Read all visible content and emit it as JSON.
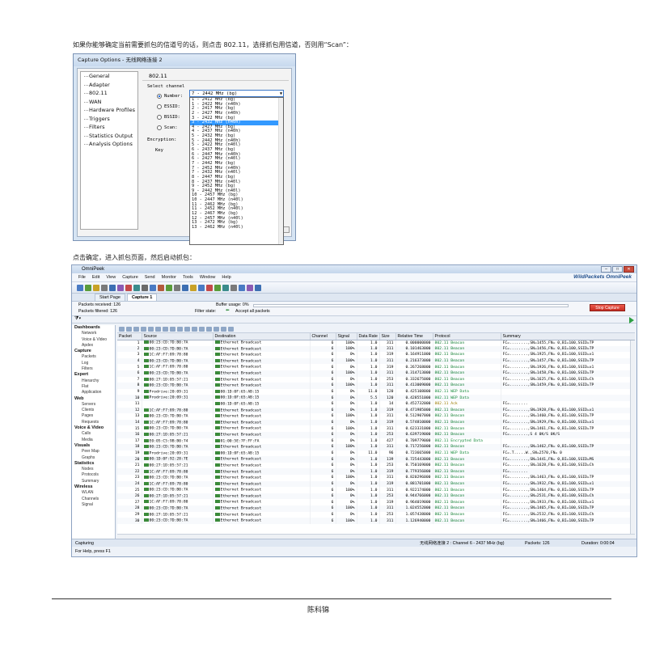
{
  "doc": {
    "caption_top": "如果你能够确定当前需要抓包的信道号的话，则点击 802.11，选择抓包用信道，否则用“Scan”：",
    "caption_mid": "点击确定，进入抓包页面，然后启动抓包：",
    "footer": "陈科锦"
  },
  "dialog": {
    "title": "Capture Options - 无线网络连接 2",
    "tree": [
      "General",
      "Adapter",
      "802.11",
      "WAN",
      "Hardware Profiles",
      "Triggers",
      "Filters",
      "Statistics Output",
      "Analysis Options"
    ],
    "panel_title": "802.11",
    "select_channel_label": "Select channel",
    "options": [
      "Number:",
      "ESSID:",
      "BSSID:",
      "Scan:"
    ],
    "encryption_label": "Encryption:",
    "key_label": "Key",
    "selected_value": "7 - 2442 MHz (bg)",
    "dropdown": [
      "1 - 2412 MHz (bg)",
      "1 - 2422 MHz (n40h)",
      "2 - 2417 MHz (bg)",
      "2 - 2427 MHz (n40h)",
      "3 - 2422 MHz (bg)",
      "3 - 2432 MHz (n40h)",
      "4 - 2427 MHz (bg)",
      "4 - 2437 MHz (n40h)",
      "5 - 2432 MHz (bg)",
      "5 - 2442 MHz (n40h)",
      "5 - 2422 MHz (n40l)",
      "6 - 2437 MHz (bg)",
      "6 - 2447 MHz (n40h)",
      "6 - 2427 MHz (n40l)",
      "7 - 2442 MHz (bg)",
      "7 - 2452 MHz (n40h)",
      "7 - 2432 MHz (n40l)",
      "8 - 2447 MHz (bg)",
      "8 - 2437 MHz (n40l)",
      "9 - 2452 MHz (bg)",
      "9 - 2442 MHz (n40l)",
      "10 - 2457 MHz (bg)",
      "10 - 2447 MHz (n40l)",
      "11 - 2462 MHz (bg)",
      "11 - 2452 MHz (n40l)",
      "12 - 2467 MHz (bg)",
      "12 - 2457 MHz (n40l)",
      "13 - 2472 MHz (bg)",
      "13 - 2462 MHz (n40l)"
    ],
    "dropdown_selected_index": 5
  },
  "app": {
    "title": "OmniPeek",
    "menu": [
      "File",
      "Edit",
      "View",
      "Capture",
      "Send",
      "Monitor",
      "Tools",
      "Window",
      "Help"
    ],
    "brand": "WildPackets OmniPeek",
    "tabs": [
      "Start Page",
      "Capture 1"
    ],
    "status": {
      "packets_received": "Packets received: 126",
      "packets_filtered": "Packets filtered: 126",
      "buffer_usage": "Buffer usage: 0%",
      "filter_state": "Filter state:",
      "filter_value": "Accept all packets",
      "stop_button": "Stop Capture"
    },
    "nav": [
      {
        "cat": "Dashboards",
        "items": [
          "Network",
          "Voice & Video",
          "Apdex"
        ]
      },
      {
        "cat": "Capture",
        "items": [
          "Packets",
          "Log",
          "Filters"
        ]
      },
      {
        "cat": "Expert",
        "items": [
          "Hierarchy",
          "Flat",
          "Application"
        ]
      },
      {
        "cat": "Web",
        "items": [
          "Servers",
          "Clients",
          "Pages",
          "Requests"
        ]
      },
      {
        "cat": "Voice & Video",
        "items": [
          "Calls",
          "Media"
        ]
      },
      {
        "cat": "Visuals",
        "items": [
          "Peer Map",
          "Graphs"
        ]
      },
      {
        "cat": "Statistics",
        "items": [
          "Nodes",
          "Protocols",
          "Summary"
        ]
      },
      {
        "cat": "Wireless",
        "items": [
          "WLAN",
          "Channels",
          "Signal"
        ]
      }
    ],
    "columns": [
      "Packet",
      "Source",
      "Destination",
      "Channel",
      "Signal",
      "Data Rate",
      "Size",
      "Relative Time",
      "Protocol",
      "Summary"
    ],
    "rows": [
      [
        "1",
        "00:23:CD:7D:B0:7A",
        "Ethernet Broadcast",
        "6",
        "100%",
        "1.0",
        "311",
        "0.000000000",
        "802.11 Beacon",
        "FC=........,SN=1455,FN= 0,BI=100,SSID=TP"
      ],
      [
        "2",
        "00:23:CD:7D:B0:7A",
        "Ethernet Broadcast",
        "6",
        "100%",
        "1.0",
        "311",
        "0.101463000",
        "802.11 Beacon",
        "FC=........,SN=1456,FN= 0,BI=100,SSID=TP"
      ],
      [
        "3",
        "1C:AF:F7:89:78:80",
        "Ethernet Broadcast",
        "6",
        "0%",
        "1.0",
        "319",
        "0.164911000",
        "802.11 Beacon",
        "FC=........,SN=1925,FN= 0,BI=100,SSID=x1"
      ],
      [
        "4",
        "00:23:CD:7D:B0:7A",
        "Ethernet Broadcast",
        "6",
        "100%",
        "1.0",
        "311",
        "0.216373000",
        "802.11 Beacon",
        "FC=........,SN=1457,FN= 0,BI=100,SSID=TP"
      ],
      [
        "5",
        "1C:AF:F7:89:78:80",
        "Ethernet Broadcast",
        "6",
        "0%",
        "1.0",
        "319",
        "0.267268000",
        "802.11 Beacon",
        "FC=........,SN=1926,FN= 0,BI=100,SSID=x1"
      ],
      [
        "6",
        "00:23:CD:7D:B0:7A",
        "Ethernet Broadcast",
        "6",
        "100%",
        "1.0",
        "311",
        "0.314713000",
        "802.11 Beacon",
        "FC=........,SN=1458,FN= 0,BI=100,SSID=TP"
      ],
      [
        "7",
        "00:27:1D:05:57:21",
        "Ethernet Broadcast",
        "6",
        "0%",
        "1.0",
        "253",
        "0.332675000",
        "802.11 Beacon",
        "FC=........,SN=1625,FN= 0,BI=100,SSID=Ch"
      ],
      [
        "8",
        "00:23:CD:7D:B0:7A",
        "Ethernet Broadcast",
        "6",
        "100%",
        "1.0",
        "311",
        "0.413009000",
        "802.11 Beacon",
        "FC=........,SN=1459,FN= 0,BI=100,SSID=TP"
      ],
      [
        "9",
        "Prodrive:20:09:31",
        "00:1D:0F:65:AB:15",
        "6",
        "0%",
        "11.0",
        "120",
        "0.425108000",
        "802.11 WEP Data",
        ""
      ],
      [
        "10",
        "Prodrive:20:09:31",
        "00:1D:0F:65:AB:15",
        "6",
        "0%",
        "5.5",
        "120",
        "0.428551000",
        "802.11 WEP Data",
        ""
      ],
      [
        "11",
        "",
        "00:1D:0F:65:AB:15",
        "6",
        "0%",
        "1.0",
        "14",
        "0.452732000",
        "802.11 Ack",
        "FC=........"
      ],
      [
        "12",
        "1C:AF:F7:89:78:80",
        "Ethernet Broadcast",
        "6",
        "0%",
        "1.0",
        "319",
        "0.471985000",
        "802.11 Beacon",
        "FC=........,SN=1928,FN= 0,BI=100,SSID=x1"
      ],
      [
        "13",
        "00:23:CD:7D:B0:7A",
        "Ethernet Broadcast",
        "6",
        "100%",
        "1.0",
        "311",
        "0.512907000",
        "802.11 Beacon",
        "FC=........,SN=1460,FN= 0,BI=100,SSID=TP"
      ],
      [
        "14",
        "1C:AF:F7:89:78:80",
        "Ethernet Broadcast",
        "6",
        "0%",
        "1.0",
        "319",
        "0.574810000",
        "802.11 Beacon",
        "FC=........,SN=1929,FN= 0,BI=100,SSID=x1"
      ],
      [
        "15",
        "00:23:CD:7D:B0:7A",
        "Ethernet Broadcast",
        "6",
        "100%",
        "1.0",
        "311",
        "0.623331000",
        "802.11 Beacon",
        "FC=........,SN=1461,FN= 0,BI=100,SSID=TP"
      ],
      [
        "16",
        "00:27:1D:05:57:21",
        "Ethernet Broadcast",
        "6",
        "0%",
        "1.0",
        "253",
        "0.639719000",
        "802.11 Beacon",
        "FC=........,S  4   0K/S  0K/S"
      ],
      [
        "17",
        "E0:05:C5:9B:B0:74",
        "01:00:5E:7F:FF:FA",
        "6",
        "0%",
        "1.0",
        "427",
        "0.709779000",
        "802.11 Encrypted Data",
        ""
      ],
      [
        "18",
        "00:23:CD:7D:B0:7A",
        "Ethernet Broadcast",
        "6",
        "100%",
        "1.0",
        "311",
        "0.717256000",
        "802.11 Beacon",
        "FC=........,SN=1462,FN= 0,BI=100,SSID=TP"
      ],
      [
        "19",
        "Prodrive:20:09:31",
        "00:1D:0F:65:AB:15",
        "6",
        "0%",
        "11.0",
        "96",
        "0.723665000",
        "802.11 WEP Data",
        "FC=.T.....W.,SN=2570,FN= 0"
      ],
      [
        "20",
        "00:1D:0F:92:28:7E",
        "Ethernet Broadcast",
        "6",
        "0%",
        "1.0",
        "139",
        "0.725443000",
        "802.11 Beacon",
        "FC=........,SN=1441,FN= 0,BI=100,SSID=MS"
      ],
      [
        "21",
        "00:27:1D:05:57:21",
        "Ethernet Broadcast",
        "6",
        "0%",
        "1.0",
        "253",
        "0.750169000",
        "802.11 Beacon",
        "FC=........,SN=1628,FN= 0,BI=100,SSID=Ch"
      ],
      [
        "22",
        "1C:AF:F7:89:78:80",
        "Ethernet Broadcast",
        "6",
        "0%",
        "1.0",
        "319",
        "0.779356000",
        "802.11 Beacon",
        "FC=........"
      ],
      [
        "23",
        "00:23:CD:7D:B0:7A",
        "Ethernet Broadcast",
        "6",
        "100%",
        "1.0",
        "311",
        "0.820296000",
        "802.11 Beacon",
        "FC=........,SN=1463,FN= 0,BI=100,SSID=TP"
      ],
      [
        "24",
        "1C:AF:F7:89:78:80",
        "Ethernet Broadcast",
        "6",
        "0%",
        "1.0",
        "319",
        "0.881701000",
        "802.11 Beacon",
        "FC=........,SN=1932,FN= 0,BI=100,SSID=x1"
      ],
      [
        "25",
        "00:23:CD:7D:B0:7A",
        "Ethernet Broadcast",
        "6",
        "100%",
        "1.0",
        "311",
        "0.922174000",
        "802.11 Beacon",
        "FC=........,SN=1464,FN= 0,BI=100,SSID=TP"
      ],
      [
        "26",
        "00:27:1D:05:57:21",
        "Ethernet Broadcast",
        "6",
        "0%",
        "1.0",
        "253",
        "0.944766000",
        "802.11 Beacon",
        "FC=........,SN=2531,FN= 0,BI=100,SSID=Ch"
      ],
      [
        "27",
        "1C:AF:F7:89:78:80",
        "Ethernet Broadcast",
        "6",
        "0%",
        "1.0",
        "319",
        "0.964019000",
        "802.11 Beacon",
        "FC=........,SN=1933,FN= 0,BI=100,SSID=x1"
      ],
      [
        "28",
        "00:23:CD:7D:B0:7A",
        "Ethernet Broadcast",
        "6",
        "100%",
        "1.0",
        "311",
        "1.024552000",
        "802.11 Beacon",
        "FC=........,SN=1465,FN= 0,BI=100,SSID=TP"
      ],
      [
        "29",
        "00:27:1D:05:57:21",
        "Ethernet Broadcast",
        "6",
        "0%",
        "1.0",
        "253",
        "1.057438000",
        "802.11 Beacon",
        "FC=........,SN=2532,FN= 0,BI=100,SSID=Ch"
      ],
      [
        "30",
        "00:23:CD:7D:B0:7A",
        "Ethernet Broadcast",
        "6",
        "100%",
        "1.0",
        "311",
        "1.126940000",
        "802.11 Beacon",
        "FC=........,SN=1466,FN= 0,BI=100,SSID=TP"
      ]
    ],
    "status_bottom": {
      "left": "Capturing",
      "adapter": "无线网络连接 2 : Channel 6 - 2437 MHz (bg)",
      "packets": "Packets: 126",
      "duration": "Duration: 0:00:04",
      "help": "For Help, press F1"
    }
  }
}
